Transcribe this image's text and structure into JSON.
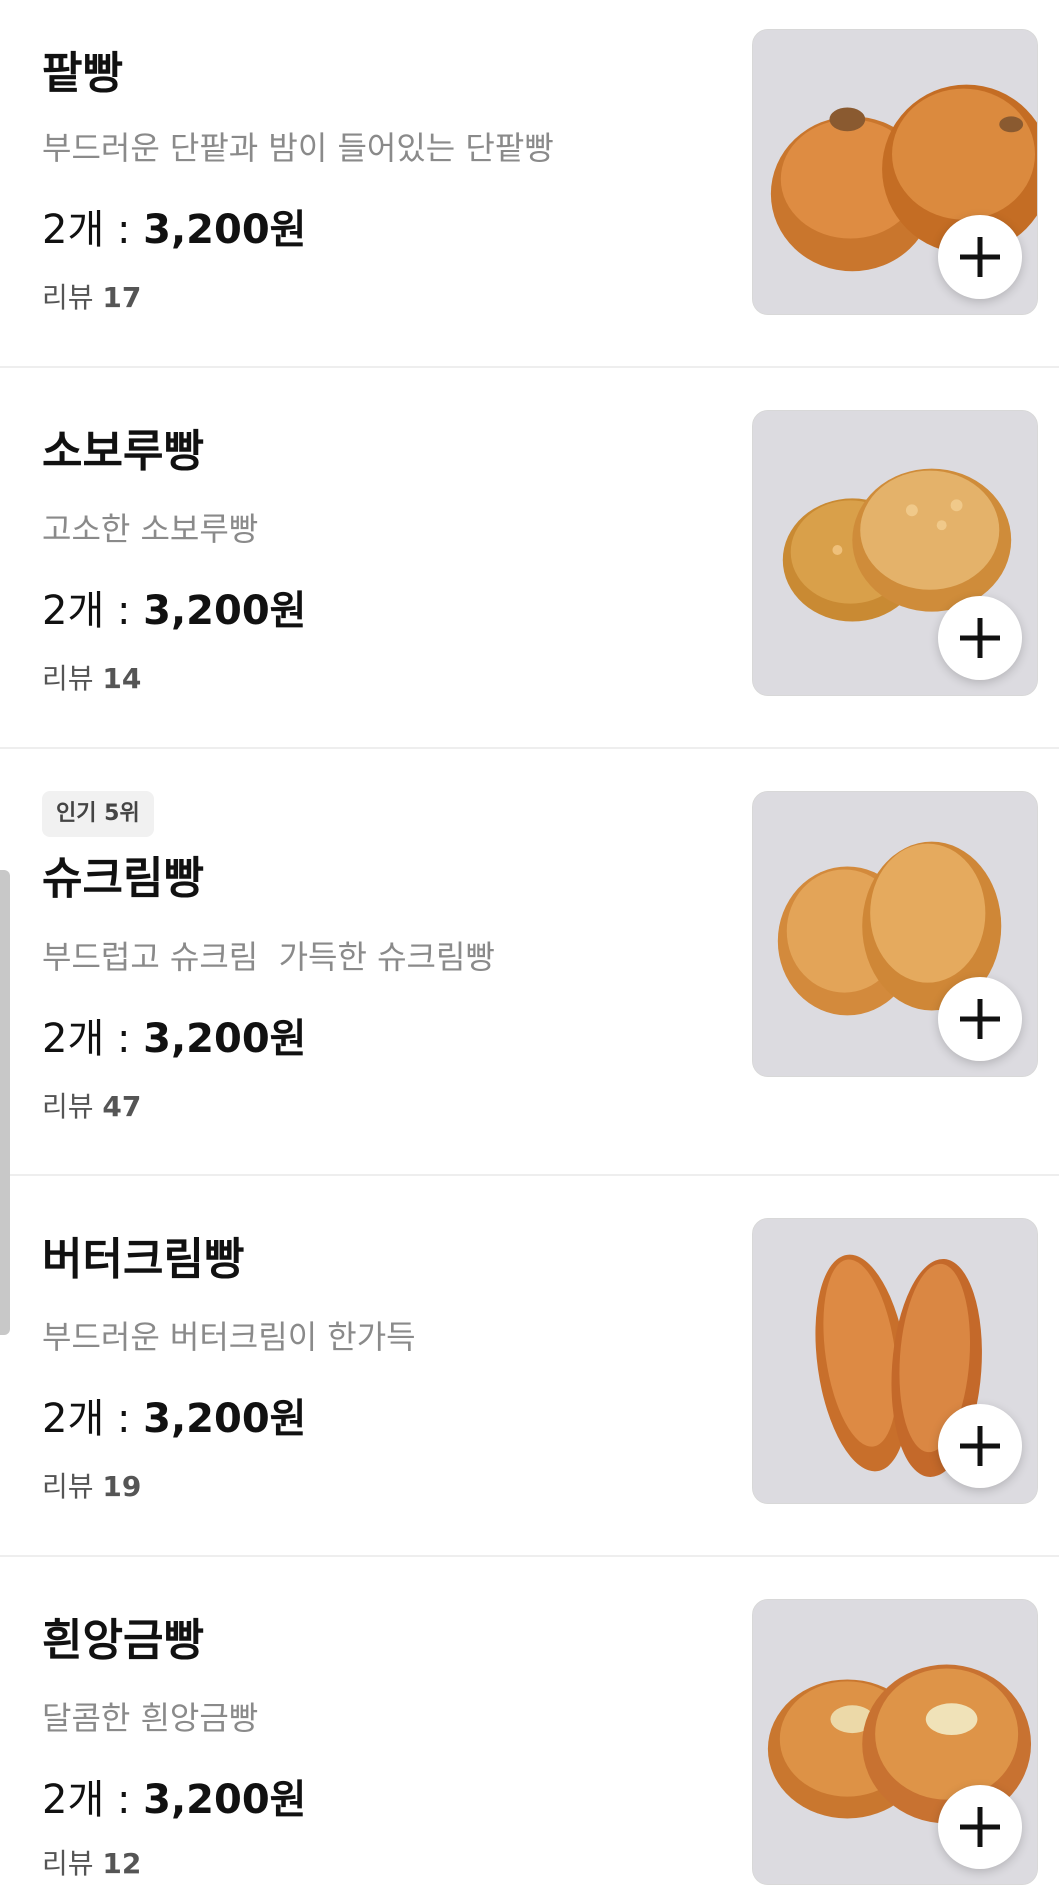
{
  "menu": {
    "items": [
      {
        "name": "팥빵",
        "description": "부드러운 단팥과 밤이 들어있는 단팥빵",
        "quantity": "2개 : ",
        "price": "3,200원",
        "review_label": "리뷰 ",
        "review_count": "17",
        "badge": null,
        "image": "red-bean-bread-photo"
      },
      {
        "name": "소보루빵",
        "description": "고소한 소보루빵",
        "quantity": "2개 : ",
        "price": "3,200원",
        "review_label": "리뷰 ",
        "review_count": "14",
        "badge": null,
        "image": "soboro-bread-photo"
      },
      {
        "name": "슈크림빵",
        "description": "부드럽고 슈크림  가득한 슈크림빵",
        "quantity": "2개 : ",
        "price": "3,200원",
        "review_label": "리뷰 ",
        "review_count": "47",
        "badge": "인기 5위",
        "image": "cream-bread-photo"
      },
      {
        "name": "버터크림빵",
        "description": "부드러운 버터크림이 한가득",
        "quantity": "2개 : ",
        "price": "3,200원",
        "review_label": "리뷰 ",
        "review_count": "19",
        "badge": null,
        "image": "butter-cream-bread-photo"
      },
      {
        "name": "흰앙금빵",
        "description": "달콤한 흰앙금빵",
        "quantity": "2개 : ",
        "price": "3,200원",
        "review_label": "리뷰 ",
        "review_count": "12",
        "badge": null,
        "image": "white-bean-bread-photo"
      }
    ]
  },
  "icons": {
    "add": "plus-icon"
  },
  "colors": {
    "title": "#111111",
    "description": "#8a8a8a",
    "review": "#555555",
    "divider": "#eeeeee",
    "badge_bg": "#f1f1f1"
  }
}
